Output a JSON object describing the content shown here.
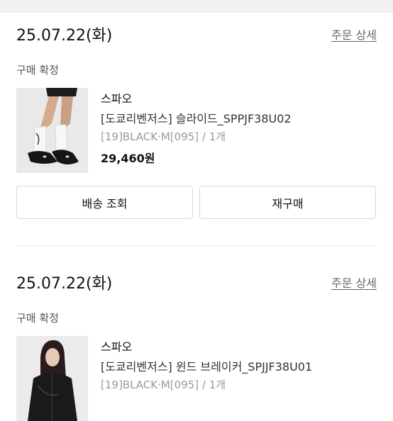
{
  "orders": [
    {
      "date": "25.07.22(화)",
      "detail_link": "주문 상세",
      "status": "구매 확정",
      "product": {
        "brand": "스파오",
        "name": "[도쿄리벤저스] 슬라이드_SPPJF38U02",
        "option": "[19]BLACK·M[095] / 1개",
        "price": "29,460원",
        "image": "photo of legs wearing white socks and black slides"
      },
      "buttons": {
        "delivery": "배송 조회",
        "reorder": "재구매"
      }
    },
    {
      "date": "25.07.22(화)",
      "detail_link": "주문 상세",
      "status": "구매 확정",
      "product": {
        "brand": "스파오",
        "name": "[도쿄리벤저스] 윈드 브레이커_SPJJF38U01",
        "option": "[19]BLACK·M[095] / 1개",
        "image": "photo of model wearing black windbreaker"
      }
    }
  ],
  "colors": {
    "top_bar": "#f1f1f3",
    "link": "#666666",
    "muted": "#999999",
    "border": "#d9d9d9"
  }
}
